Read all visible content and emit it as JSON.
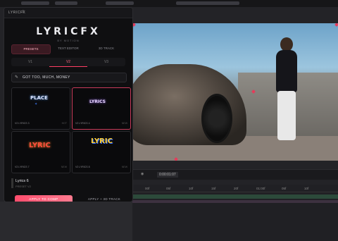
{
  "panel": {
    "title": "LYRICFX",
    "menu_icon": "menu-icon",
    "logo": "LYRICFX",
    "logo_sub": "BY MOTION",
    "tabs": [
      {
        "label": "PRESETS",
        "active": true
      },
      {
        "label": "TEXT EDITOR",
        "active": false
      },
      {
        "label": "3D TRACK",
        "active": false
      }
    ],
    "versions": [
      {
        "label": "V1",
        "active": false
      },
      {
        "label": "V2",
        "active": true
      },
      {
        "label": "V3",
        "active": false
      }
    ],
    "search": {
      "icon": "edit-icon",
      "value": "GOT TOO, MUCH, MONEY"
    },
    "presets": [
      {
        "name": "V2 LYRICS 3",
        "tag": "HOT",
        "selected": false,
        "art": "PLACE"
      },
      {
        "name": "V2 LYRICS 4",
        "tag": "NEW",
        "selected": true,
        "art": "LYRICS"
      },
      {
        "name": "V2 LYRICS 7",
        "tag": "NEW",
        "selected": false,
        "art": "LYRIC"
      },
      {
        "name": "V2 LYRICS 8",
        "tag": "NEW",
        "selected": false,
        "art": "LYRIC"
      }
    ],
    "selected_preset": {
      "name": "Lyrics 6",
      "sub": "PRESET V2"
    },
    "apply_button": "APPLY TO COMP",
    "apply_3d_button": "APPLY + 3D TRACK"
  },
  "viewer": {
    "zoom_icon": "camera-icon",
    "timecode": "0:00:01:07"
  },
  "timeline": {
    "ticks": [
      "00f",
      "05f",
      "10f",
      "15f",
      "20f",
      "01:00f",
      "05f",
      "10f"
    ]
  },
  "colors": {
    "accent": "#ff4d6d",
    "panel_bg": "#0f0f11"
  }
}
